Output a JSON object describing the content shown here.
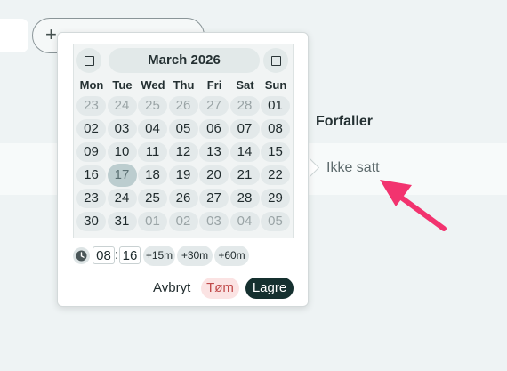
{
  "background": {
    "column_header": "Forfaller",
    "cell_value": "Ikke satt"
  },
  "calendar": {
    "month_title": "March 2026",
    "weekdays": [
      "Mon",
      "Tue",
      "Wed",
      "Thu",
      "Fri",
      "Sat",
      "Sun"
    ],
    "weeks": [
      [
        {
          "d": "23",
          "o": true
        },
        {
          "d": "24",
          "o": true
        },
        {
          "d": "25",
          "o": true
        },
        {
          "d": "26",
          "o": true
        },
        {
          "d": "27",
          "o": true
        },
        {
          "d": "28",
          "o": true
        },
        {
          "d": "01",
          "o": false
        }
      ],
      [
        {
          "d": "02",
          "o": false
        },
        {
          "d": "03",
          "o": false
        },
        {
          "d": "04",
          "o": false
        },
        {
          "d": "05",
          "o": false
        },
        {
          "d": "06",
          "o": false
        },
        {
          "d": "07",
          "o": false
        },
        {
          "d": "08",
          "o": false
        }
      ],
      [
        {
          "d": "09",
          "o": false
        },
        {
          "d": "10",
          "o": false
        },
        {
          "d": "11",
          "o": false
        },
        {
          "d": "12",
          "o": false
        },
        {
          "d": "13",
          "o": false
        },
        {
          "d": "14",
          "o": false
        },
        {
          "d": "15",
          "o": false
        }
      ],
      [
        {
          "d": "16",
          "o": false
        },
        {
          "d": "17",
          "o": false,
          "today": true
        },
        {
          "d": "18",
          "o": false
        },
        {
          "d": "19",
          "o": false
        },
        {
          "d": "20",
          "o": false
        },
        {
          "d": "21",
          "o": false
        },
        {
          "d": "22",
          "o": false
        }
      ],
      [
        {
          "d": "23",
          "o": false
        },
        {
          "d": "24",
          "o": false
        },
        {
          "d": "25",
          "o": false
        },
        {
          "d": "26",
          "o": false
        },
        {
          "d": "27",
          "o": false
        },
        {
          "d": "28",
          "o": false
        },
        {
          "d": "29",
          "o": false
        }
      ],
      [
        {
          "d": "30",
          "o": false
        },
        {
          "d": "31",
          "o": false
        },
        {
          "d": "01",
          "o": true
        },
        {
          "d": "02",
          "o": true
        },
        {
          "d": "03",
          "o": true
        },
        {
          "d": "04",
          "o": true
        },
        {
          "d": "05",
          "o": true
        }
      ]
    ]
  },
  "time": {
    "hour": "08",
    "minute": "16",
    "separator": ":",
    "increments": [
      "+15m",
      "+30m",
      "+60m"
    ]
  },
  "actions": {
    "cancel": "Avbryt",
    "clear": "Tøm",
    "save": "Lagre"
  },
  "colors": {
    "accent": "#15302f",
    "clear_bg": "#fbe3e3",
    "clear_text": "#c04a4a",
    "annotation_arrow": "#f2336f"
  }
}
